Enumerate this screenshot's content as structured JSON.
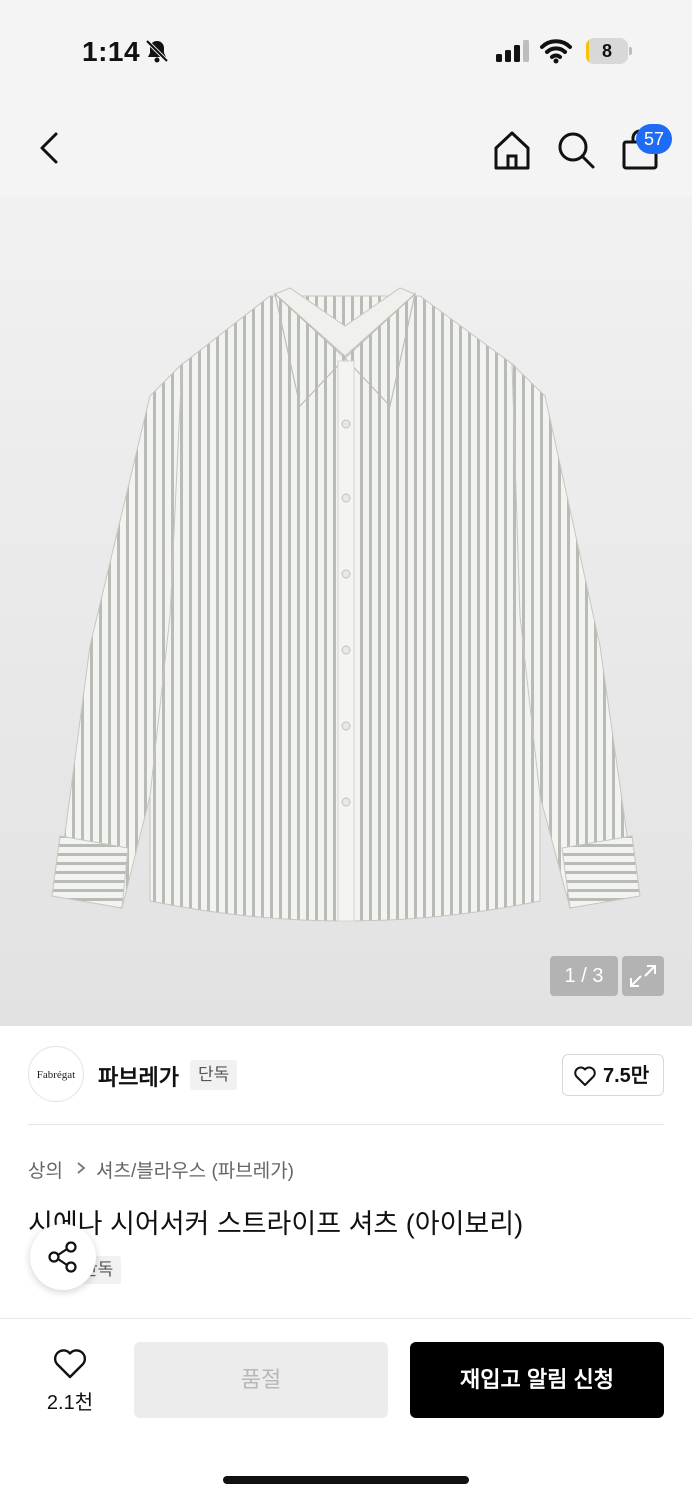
{
  "status_bar": {
    "time": "1:14",
    "battery_level": "8",
    "battery_fraction": 0.08,
    "icons": [
      "bell-slash-icon",
      "cellular-signal-icon",
      "wifi-icon",
      "battery-icon"
    ]
  },
  "nav": {
    "cart_count": "57",
    "icons": [
      "back-chevron-icon",
      "home-icon",
      "search-icon",
      "shopping-bag-icon"
    ],
    "badge_color": "#1e6cf5"
  },
  "gallery": {
    "counter": "1 / 3",
    "current": 1,
    "total": 3,
    "icon": "expand-icon"
  },
  "brand": {
    "logo_text": "Fabrégat",
    "name": "파브레가",
    "tag": "단독",
    "likes": "7.5만"
  },
  "product": {
    "breadcrumb": [
      "상의",
      "셔츠/블라우스 (파브레가)"
    ],
    "title": "시에나 시어서커 스트라이프 셔츠 (아이보리)",
    "exclusive_tag": "단독"
  },
  "bottom": {
    "wish_count": "2.1천",
    "soldout_label": "품절",
    "restock_label": "재입고 알림 신청",
    "primary_color": "#000000"
  }
}
